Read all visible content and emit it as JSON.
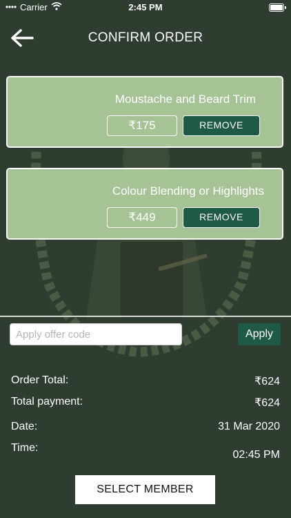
{
  "status_bar": {
    "carrier": "Carrier",
    "time": "2:45 PM"
  },
  "header": {
    "title": "CONFIRM ORDER"
  },
  "services": [
    {
      "name": "Moustache and Beard Trim",
      "price": "₹175",
      "remove_label": "REMOVE"
    },
    {
      "name": "Colour Blending or Highlights",
      "price": "₹449",
      "remove_label": "REMOVE"
    }
  ],
  "offer": {
    "placeholder": "Apply offer code",
    "value": "",
    "apply_label": "Apply"
  },
  "summary": {
    "order_total_label": "Order Total:",
    "order_total_value": "₹624",
    "total_payment_label": "Total payment:",
    "total_payment_value": "₹624",
    "date_label": "Date:",
    "date_value": "31 Mar 2020",
    "time_label": "Time:",
    "time_value": "02:45 PM"
  },
  "select_member_label": "SELECT MEMBER",
  "colors": {
    "background": "#2f3d30",
    "card": "#a5c395",
    "accent": "#1e5a46"
  }
}
